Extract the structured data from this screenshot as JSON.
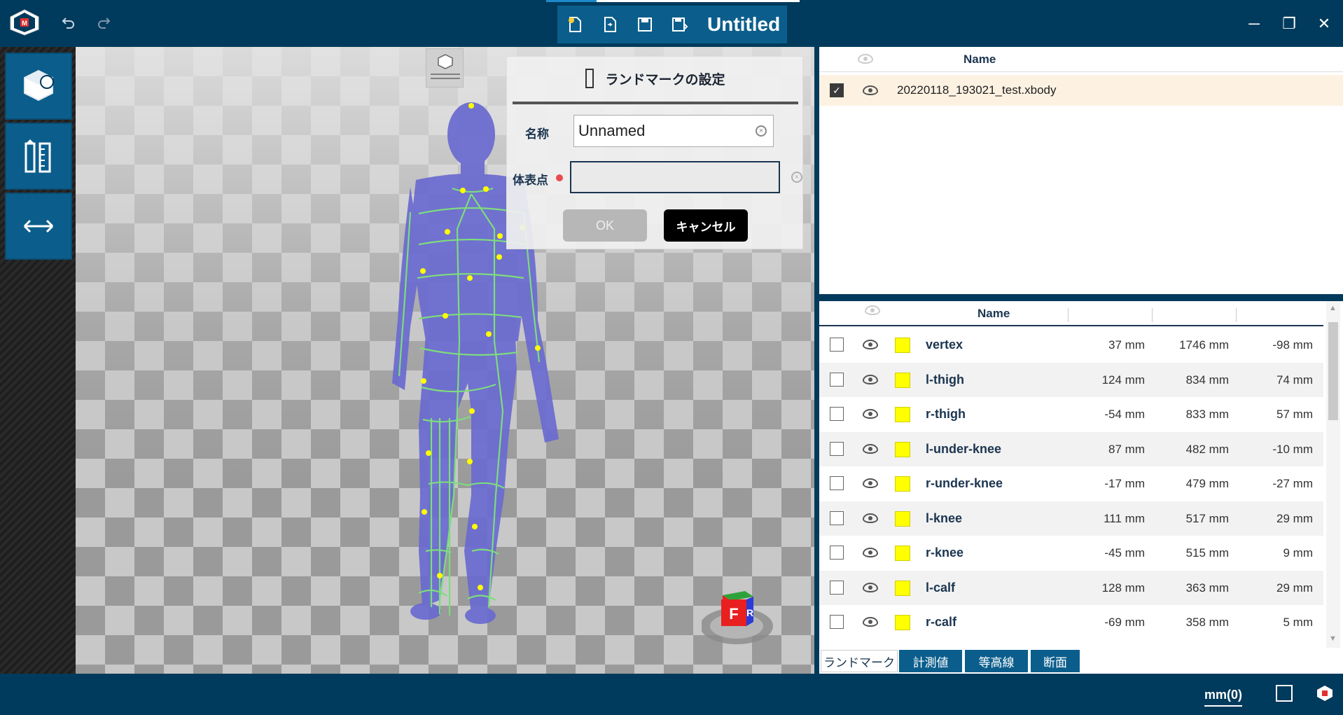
{
  "window": {
    "title": "Untitled",
    "minimize": "─",
    "maximize": "❐",
    "close": "✕"
  },
  "toolbar": {
    "undo_icon": "undo-icon",
    "redo_icon": "redo-icon",
    "new_icon": "new-file-icon",
    "open_icon": "open-file-icon",
    "save_icon": "save-icon",
    "save_as_icon": "save-as-icon"
  },
  "left_tools": [
    {
      "icon": "body-model-icon"
    },
    {
      "icon": "measure-tools-icon"
    },
    {
      "icon": "distance-icon"
    }
  ],
  "dialog": {
    "title": "ランドマークの設定",
    "name_label": "名称",
    "name_value": "Unnamed",
    "point_label": "体表点",
    "point_value": "",
    "ok": "OK",
    "cancel": "キャンセル"
  },
  "nav_cube": {
    "front": "F",
    "right": "R"
  },
  "files": {
    "header": "Name",
    "rows": [
      {
        "name": "20220118_193021_test.xbody",
        "checked": true
      }
    ]
  },
  "landmarks": {
    "header": "Name",
    "rows": [
      {
        "name": "vertex",
        "x": "37 mm",
        "y": "1746 mm",
        "z": "-98 mm"
      },
      {
        "name": "l-thigh",
        "x": "124 mm",
        "y": "834 mm",
        "z": "74 mm"
      },
      {
        "name": "r-thigh",
        "x": "-54 mm",
        "y": "833 mm",
        "z": "57 mm"
      },
      {
        "name": "l-under-knee",
        "x": "87 mm",
        "y": "482 mm",
        "z": "-10 mm"
      },
      {
        "name": "r-under-knee",
        "x": "-17 mm",
        "y": "479 mm",
        "z": "-27 mm"
      },
      {
        "name": "l-knee",
        "x": "111 mm",
        "y": "517 mm",
        "z": "29 mm"
      },
      {
        "name": "r-knee",
        "x": "-45 mm",
        "y": "515 mm",
        "z": "9 mm"
      },
      {
        "name": "l-calf",
        "x": "128 mm",
        "y": "363 mm",
        "z": "29 mm"
      },
      {
        "name": "r-calf",
        "x": "-69 mm",
        "y": "358 mm",
        "z": "5 mm"
      }
    ]
  },
  "tabs": [
    {
      "label": "ランドマーク",
      "active": true
    },
    {
      "label": "計測値",
      "active": false
    },
    {
      "label": "等高線",
      "active": false
    },
    {
      "label": "断面",
      "active": false
    }
  ],
  "status": {
    "unit": "mm(0)"
  },
  "colors": {
    "brand": "#003a5c",
    "accent": "#0b5e8c",
    "landmark": "#ffff00",
    "body": "#6a6ad0",
    "wire": "#7ddc7d"
  }
}
